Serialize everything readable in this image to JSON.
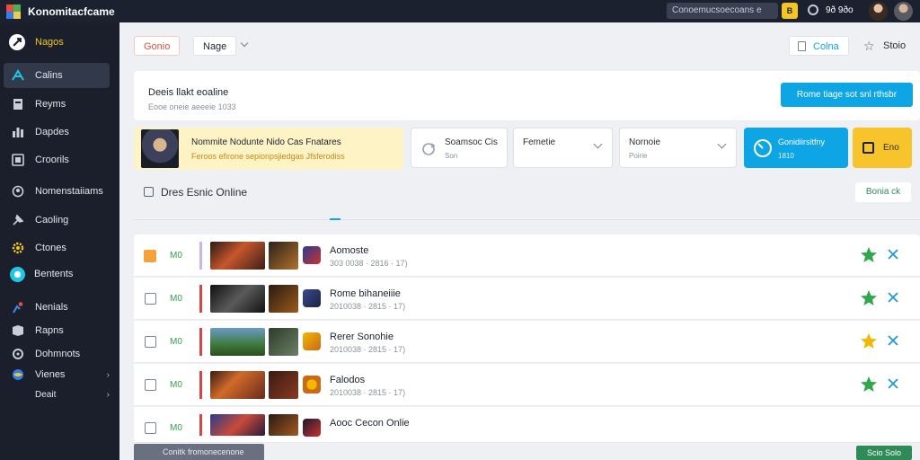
{
  "app": {
    "title": "Konomitacfcame"
  },
  "topbar": {
    "search_text": "Conoemucsoecoans e",
    "badge": "B",
    "user": "9ð 9ðo"
  },
  "sidebar": {
    "brand": "Nagos",
    "items": [
      {
        "label": "Calins",
        "icon": "gamepad-icon"
      },
      {
        "label": "Reyms",
        "icon": "bookmark-icon"
      },
      {
        "label": "Dapdes",
        "icon": "bars-icon"
      },
      {
        "label": "Croorils",
        "icon": "screen-icon"
      },
      {
        "label": "Nomenstaiiams",
        "icon": "user-icon"
      },
      {
        "label": "Caoling",
        "icon": "pin-icon"
      },
      {
        "label": "Ctones",
        "icon": "gear-icon"
      },
      {
        "label": "Bentents",
        "icon": "globe-icon"
      },
      {
        "label": "Nenials",
        "icon": "people-icon"
      },
      {
        "label": "Rapns",
        "icon": "tag-icon"
      },
      {
        "label": "Dohmnots",
        "icon": "settings-icon"
      },
      {
        "label": "Vienes",
        "icon": "planet-icon"
      },
      {
        "label": "Deait",
        "icon": ""
      }
    ]
  },
  "toolbar": {
    "btn1": "Gonio",
    "btn2": "Nage",
    "btn3": "Colna",
    "btn4": "Stoio"
  },
  "hero": {
    "title": "Deeis llakt eoaline",
    "sub": "Eooe oneie aeeeie 1033",
    "button": "Rome tiage sot snl rthsbr"
  },
  "promo": {
    "title": "Nommite Nodunte Nido Cas Fnatares",
    "sub": "Feroos efirone sepionpsjiedgas Jfsferodiss"
  },
  "filters": {
    "f1_label": "Soamsoc Cis",
    "f1_sub": "Son",
    "f2_label": "Femetie",
    "f3_label": "Nornoie",
    "f3_sub": "Poirie",
    "blue_label": "Gonidiirsitfny",
    "blue_sub": "1810",
    "yellow_label": "Eno"
  },
  "section": {
    "title": "Dres Esnic Online",
    "button": "Bonia ck"
  },
  "rows": [
    {
      "num": "M0",
      "title": "Aomoste",
      "sub": "303 0038 · 2816 · 17)"
    },
    {
      "num": "M0",
      "title": "Rome bihaneiiie",
      "sub": "2010038 · 2815 · 17)"
    },
    {
      "num": "M0",
      "title": "Rerer Sonohie",
      "sub": "2010038 · 2815 · 17)"
    },
    {
      "num": "M0",
      "title": "Falodos",
      "sub": "2010038 · 2815 · 17)"
    },
    {
      "num": "M0",
      "title": "Aooc Cecon Onlie",
      "sub": ""
    }
  ],
  "footer": {
    "status": "Conitk fromonecenone",
    "badge": "Scio Solo"
  },
  "colors": {
    "accent": "#0ea5e4",
    "star_green": "#2ea84a",
    "star_yellow": "#f2b705",
    "sidebar": "#1b1f2b"
  }
}
